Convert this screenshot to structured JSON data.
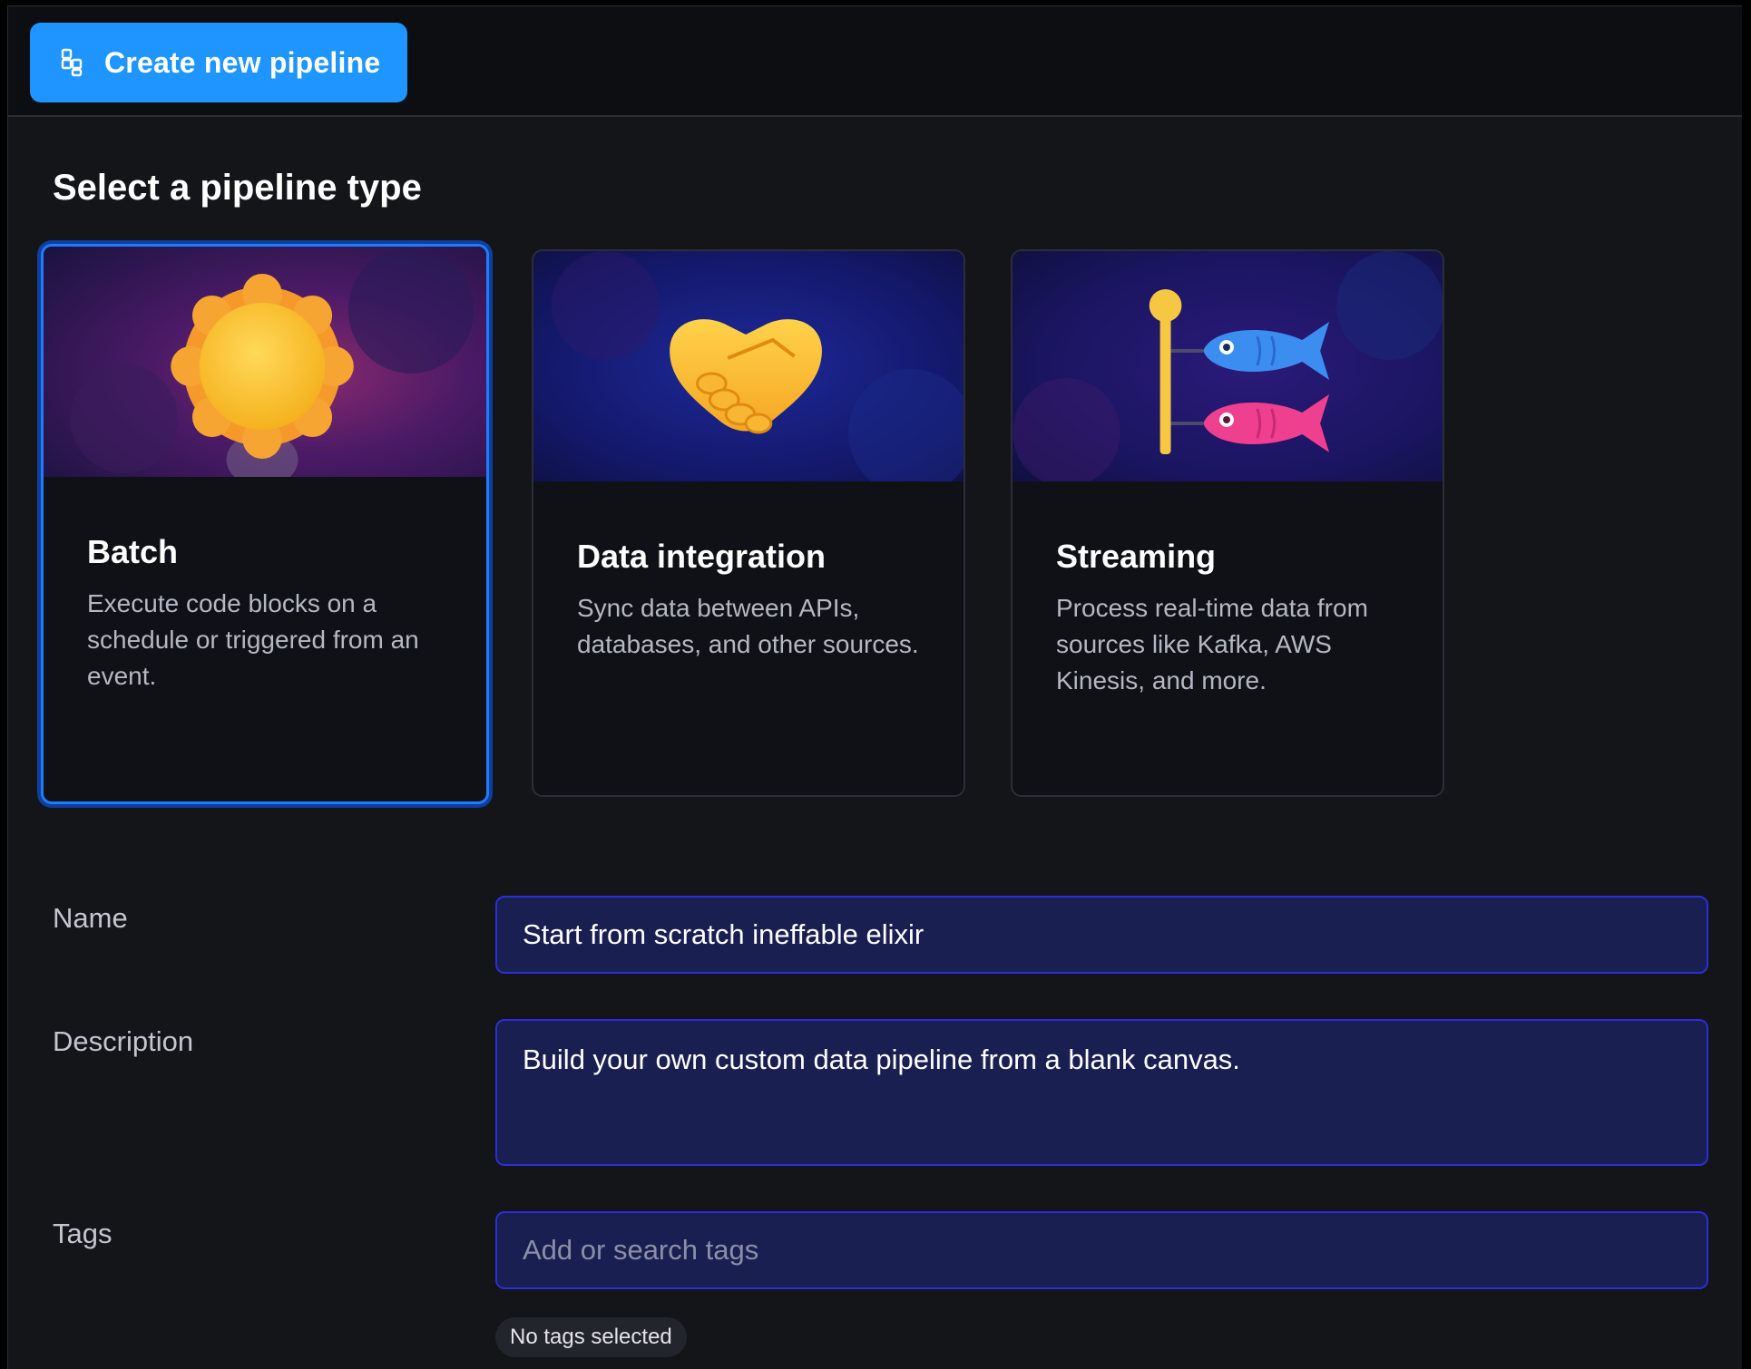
{
  "header": {
    "create_button_label": "Create new pipeline",
    "create_button_icon": "pipeline-icon",
    "accent_color": "#1f95ff"
  },
  "pipeline_types": {
    "title": "Select a pipeline type",
    "selected": "Batch",
    "cards": [
      {
        "title": "Batch",
        "description": "Execute code blocks on a schedule or triggered from an event.",
        "icon": "sun-icon"
      },
      {
        "title": "Data integration",
        "description": "Sync data between APIs, databases, and other sources.",
        "icon": "handshake-icon"
      },
      {
        "title": "Streaming",
        "description": "Process real-time data from sources like Kafka, AWS Kinesis, and more.",
        "icon": "carp-streamer-icon"
      }
    ]
  },
  "form": {
    "name_label": "Name",
    "name_value": "Start from scratch ineffable elixir",
    "description_label": "Description",
    "description_value": "Build your own custom data pipeline from a blank canvas.",
    "tags_label": "Tags",
    "tags_placeholder": "Add or search tags",
    "tags_status": "No tags selected"
  }
}
